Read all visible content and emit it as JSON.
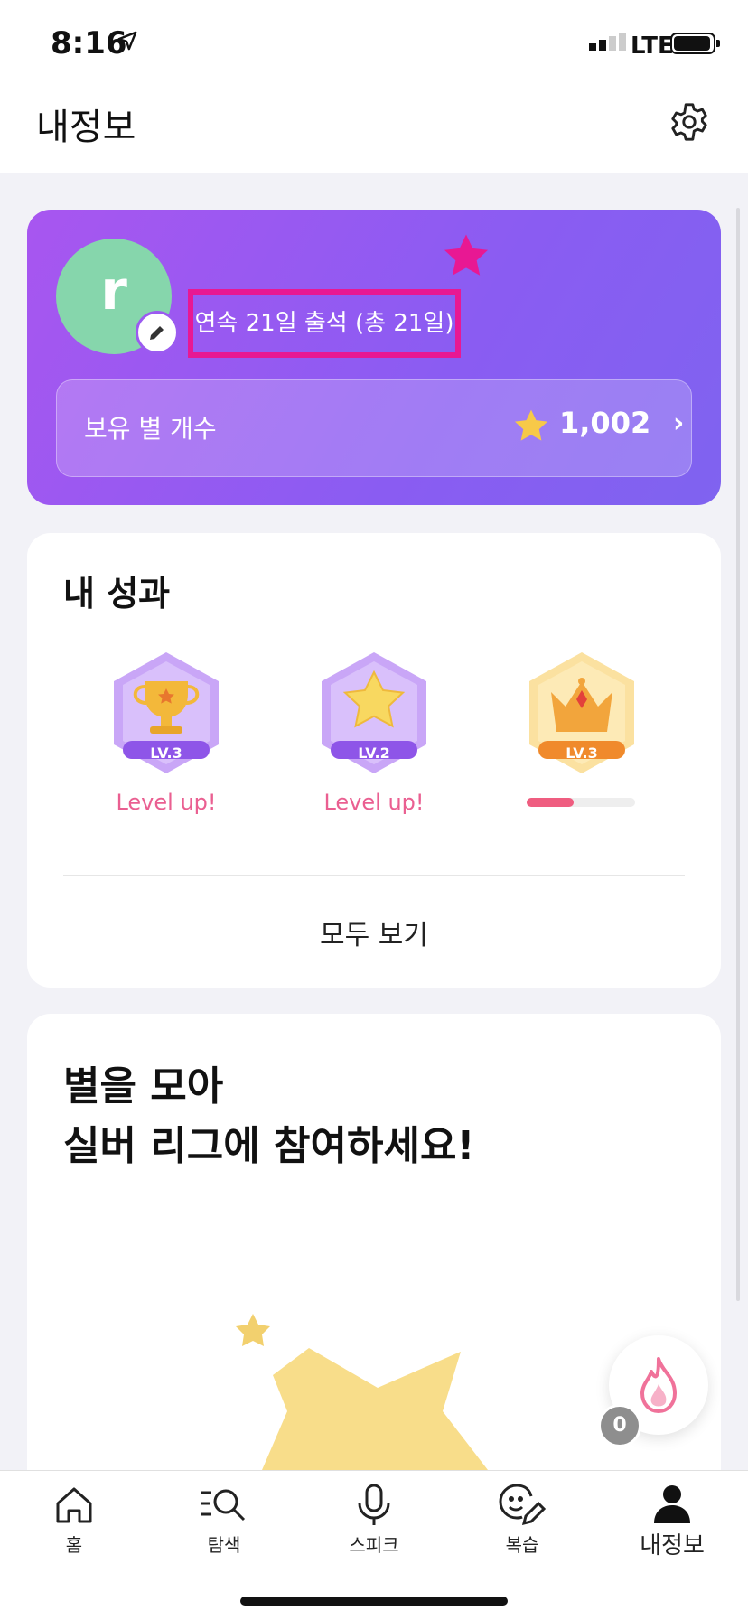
{
  "status_bar": {
    "time": "8:16",
    "network": "LTE"
  },
  "header": {
    "title": "내정보"
  },
  "profile": {
    "avatar_letter": "r",
    "attendance": "연속 21일 출석 (총 21일)",
    "stars_label": "보유 별 개수",
    "stars_count": "1,002",
    "colors": {
      "gradient_start": "#a856f0",
      "gradient_end": "#7f63f0",
      "highlight": "#e81893"
    }
  },
  "achievements": {
    "title": "내 성과",
    "badges": [
      {
        "icon": "trophy-icon",
        "level": "LV.3",
        "status": "Level up!"
      },
      {
        "icon": "star-badge-icon",
        "level": "LV.2",
        "status": "Level up!"
      },
      {
        "icon": "crown-icon",
        "level": "LV.3",
        "progress": 0.43
      }
    ],
    "view_all": "모두 보기"
  },
  "league": {
    "line1": "별을 모아",
    "line2": "실버 리그에 참여하세요!"
  },
  "fire_badge": {
    "count": "0"
  },
  "tabbar": {
    "items": [
      {
        "label": "홈",
        "icon": "home-icon"
      },
      {
        "label": "탐색",
        "icon": "search-list-icon"
      },
      {
        "label": "스피크",
        "icon": "microphone-icon"
      },
      {
        "label": "복습",
        "icon": "review-icon"
      },
      {
        "label": "내정보",
        "icon": "profile-icon",
        "active": true
      }
    ]
  }
}
